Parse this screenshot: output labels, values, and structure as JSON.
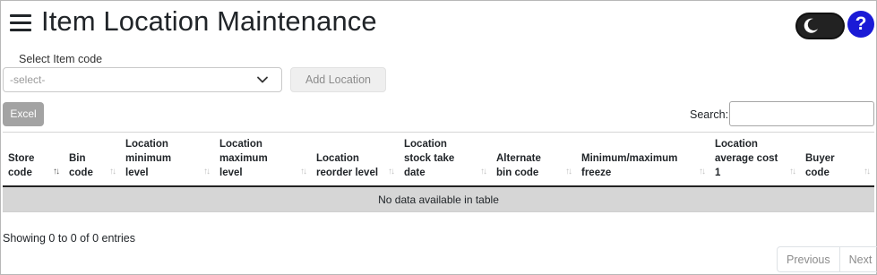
{
  "header": {
    "title": "Item Location Maintenance",
    "help_label": "?"
  },
  "form": {
    "item_label": "Select Item code",
    "item_select_value": "-select-",
    "add_location_label": "Add Location"
  },
  "toolbar": {
    "excel_label": "Excel",
    "search_label": "Search:",
    "search_value": ""
  },
  "table": {
    "columns": [
      [
        "Store",
        "code"
      ],
      [
        "Bin",
        "code"
      ],
      [
        "Location",
        "minimum",
        "level"
      ],
      [
        "Location",
        "maximum",
        "level"
      ],
      [
        "Location",
        "reorder level"
      ],
      [
        "Location",
        "stock take",
        "date"
      ],
      [
        "Alternate",
        "bin code"
      ],
      [
        "Minimum/maximum",
        "freeze"
      ],
      [
        "Location",
        "average cost",
        "1"
      ],
      [
        "Buyer",
        "code"
      ]
    ],
    "empty_message": "No data available in table"
  },
  "footer": {
    "info": "Showing 0 to 0 of 0 entries",
    "previous_label": "Previous",
    "next_label": "Next"
  },
  "colors": {
    "help_bg": "#1a1ad6",
    "empty_row_bg": "#d6d6d6",
    "excel_bg": "#a3a3a3"
  },
  "icons": {
    "menu": "hamburger-icon",
    "theme": "moon-icon",
    "select": "chevron-down-icon",
    "sort": "sort-arrows-icon"
  }
}
